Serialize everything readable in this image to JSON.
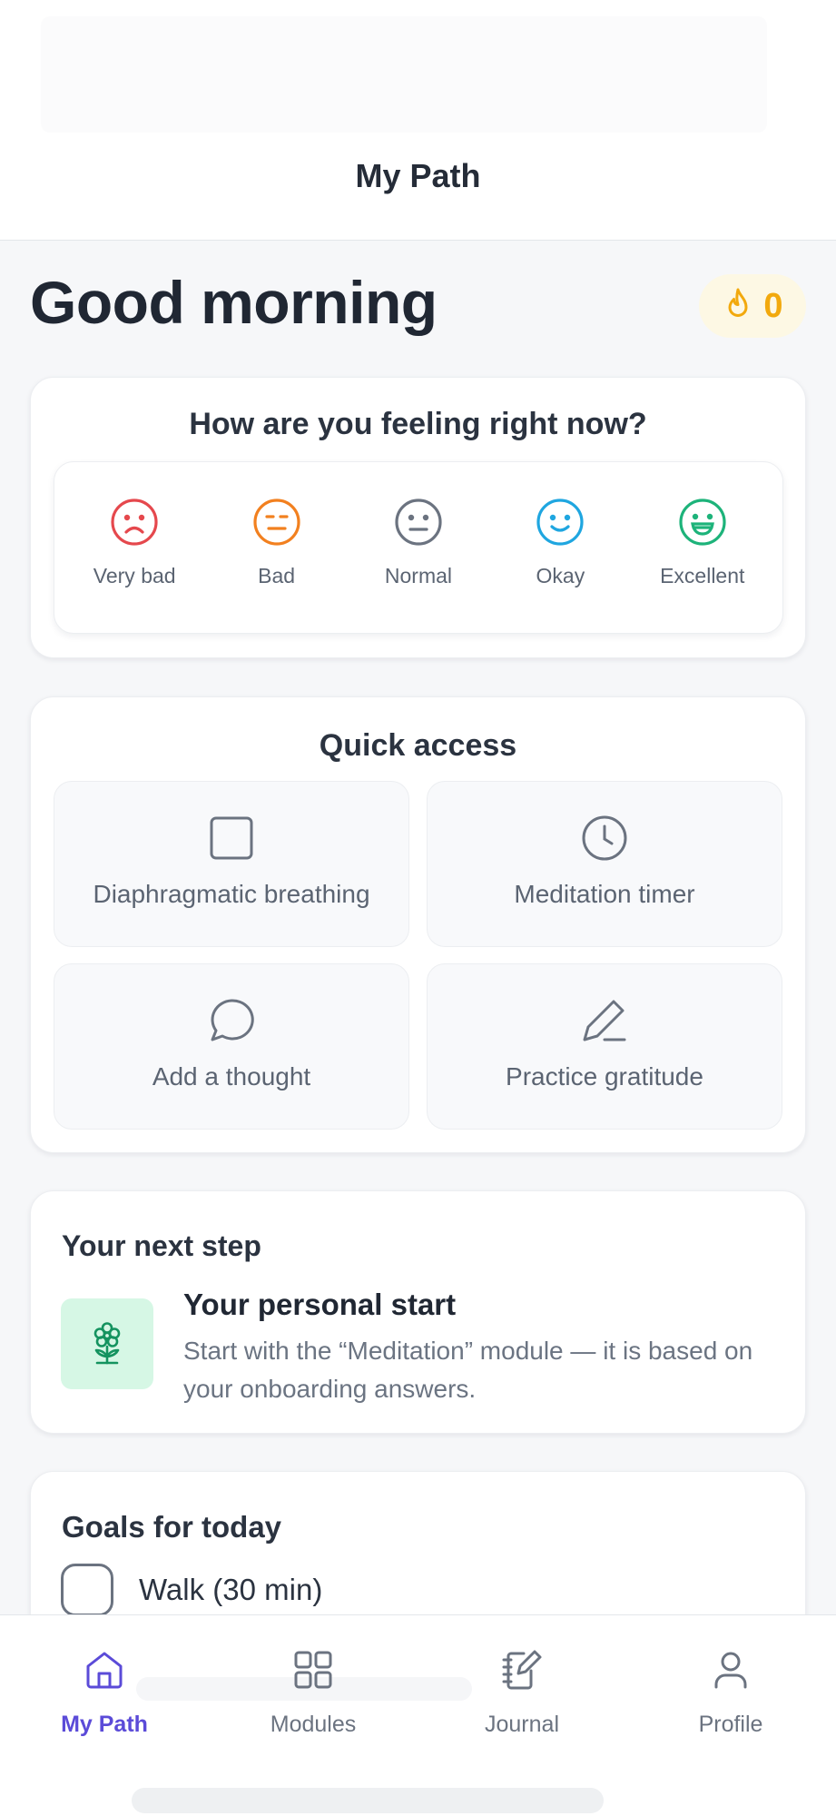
{
  "header": {
    "title": "My Path"
  },
  "greeting": "Good morning",
  "streak": {
    "count": "0",
    "icon": "flame-icon",
    "color": "#f2a90d"
  },
  "mood": {
    "title": "How are you feeling right now?",
    "options": [
      {
        "label": "Very bad",
        "icon": "frown-face-icon",
        "color": "#e5484d"
      },
      {
        "label": "Bad",
        "icon": "uneasy-face-icon",
        "color": "#f2801f"
      },
      {
        "label": "Normal",
        "icon": "neutral-face-icon",
        "color": "#6b7380"
      },
      {
        "label": "Okay",
        "icon": "smile-face-icon",
        "color": "#1fa6e0"
      },
      {
        "label": "Excellent",
        "icon": "grin-face-icon",
        "color": "#1db37a"
      }
    ]
  },
  "quick_access": {
    "title": "Quick access",
    "tiles": [
      {
        "label": "Diaphragmatic breathing",
        "icon": "square-icon"
      },
      {
        "label": "Meditation timer",
        "icon": "clock-icon"
      },
      {
        "label": "Add a thought",
        "icon": "chat-bubble-icon"
      },
      {
        "label": "Practice gratitude",
        "icon": "pencil-icon"
      }
    ]
  },
  "next_step": {
    "heading": "Your next step",
    "title": "Your personal start",
    "description": "Start with the “Meditation” module — it is based on your onboarding answers.",
    "icon": "flower-icon",
    "icon_bg": "#d6f7e5"
  },
  "goals": {
    "heading": "Goals for today",
    "items": [
      {
        "label": "Walk (30 min)",
        "checked": false
      }
    ]
  },
  "bottom_nav": {
    "active_color": "#5b4bd8",
    "items": [
      {
        "label": "My Path",
        "icon": "home-icon",
        "active": true
      },
      {
        "label": "Modules",
        "icon": "grid-icon",
        "active": false
      },
      {
        "label": "Journal",
        "icon": "journal-icon",
        "active": false
      },
      {
        "label": "Profile",
        "icon": "user-icon",
        "active": false
      }
    ]
  }
}
